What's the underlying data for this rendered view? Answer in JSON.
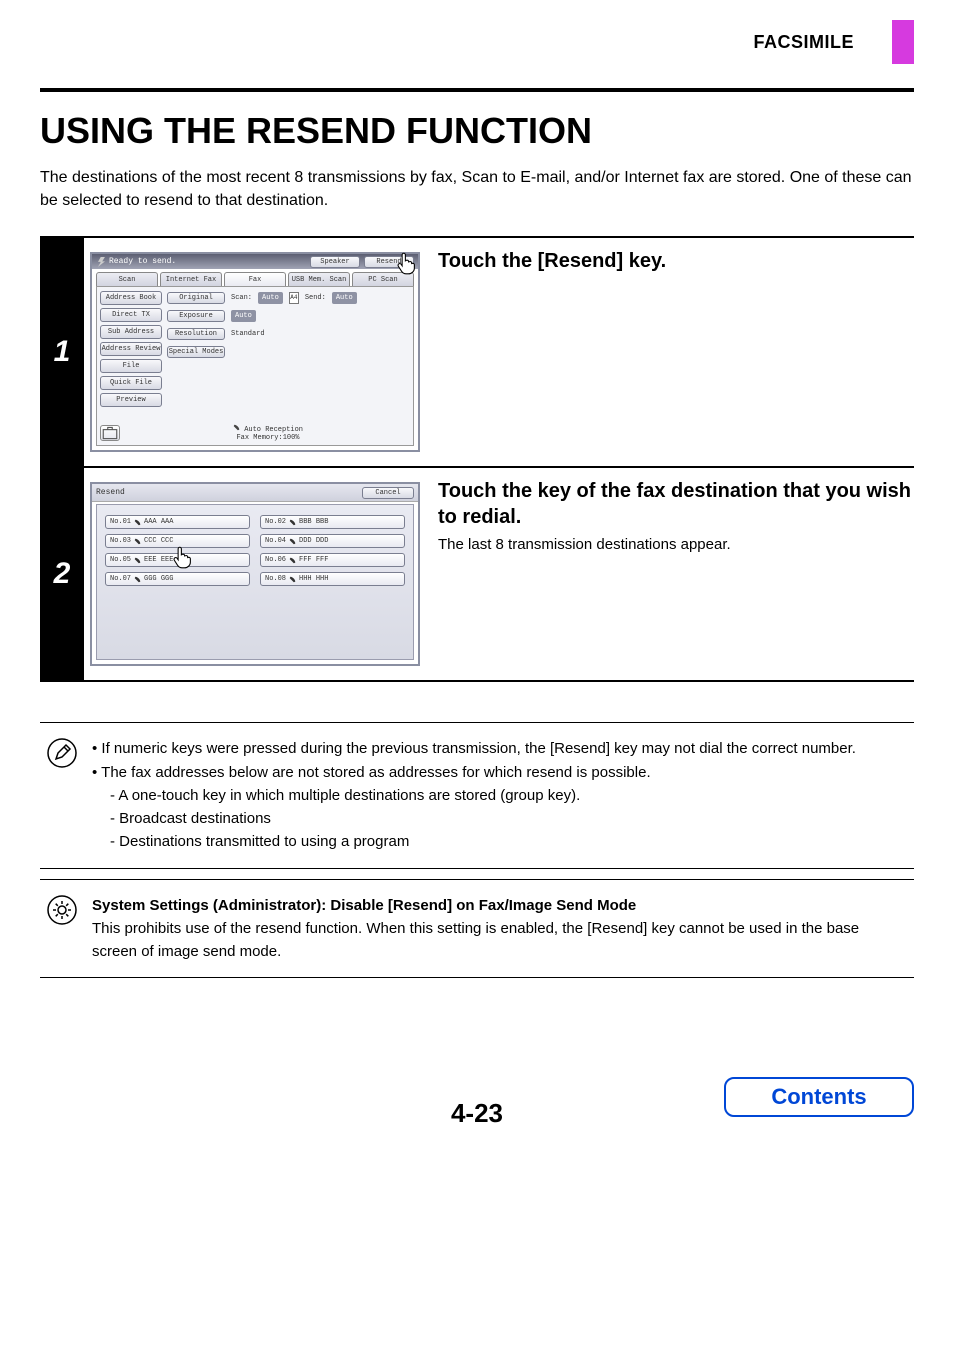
{
  "header": {
    "section": "FACSIMILE"
  },
  "title": "USING THE RESEND FUNCTION",
  "intro": "The destinations of the most recent 8 transmissions by fax, Scan to E-mail, and/or Internet fax are stored. One of these can be selected to resend to that destination.",
  "step1": {
    "num": "1",
    "heading": "Touch the [Resend] key.",
    "screen": {
      "status": "Ready to send.",
      "top_buttons": {
        "speaker": "Speaker",
        "resend": "Resend"
      },
      "tabs": [
        "Scan",
        "Internet Fax",
        "Fax",
        "USB Mem. Scan",
        "PC Scan"
      ],
      "side_buttons": [
        "Address Book",
        "Direct TX",
        "Sub Address",
        "Address Review",
        "File",
        "Quick File",
        "Preview"
      ],
      "rows": {
        "original": {
          "btn": "Original",
          "label": "Scan:",
          "chip": "Auto",
          "sheet": "A4",
          "label2": "Send:",
          "chip2": "Auto"
        },
        "exposure": {
          "btn": "Exposure",
          "val": "Auto"
        },
        "resolution": {
          "btn": "Resolution",
          "val": "Standard"
        },
        "special": {
          "btn": "Special Modes"
        }
      },
      "footer": {
        "line1": "Auto Reception",
        "line2": "Fax Memory:100%"
      }
    }
  },
  "step2": {
    "num": "2",
    "heading": "Touch the key of the fax destination that you wish to redial.",
    "sub": "The last 8 transmission destinations appear.",
    "screen": {
      "title": "Resend",
      "cancel": "Cancel",
      "items": [
        {
          "no": "No.01",
          "name": "AAA AAA"
        },
        {
          "no": "No.02",
          "name": "BBB BBB"
        },
        {
          "no": "No.03",
          "name": "CCC CCC"
        },
        {
          "no": "No.04",
          "name": "DDD DDD"
        },
        {
          "no": "No.05",
          "name": "EEE EEE"
        },
        {
          "no": "No.06",
          "name": "FFF FFF"
        },
        {
          "no": "No.07",
          "name": "GGG GGG"
        },
        {
          "no": "No.08",
          "name": "HHH HHH"
        }
      ]
    }
  },
  "notes": {
    "bul1": "If numeric keys were pressed during the previous transmission, the [Resend] key may not dial the correct number.",
    "bul2": "The fax addresses below are not stored as addresses for which resend is possible.",
    "d1": "A one-touch key in which multiple destinations are stored (group key).",
    "d2": "Broadcast destinations",
    "d3": "Destinations transmitted to using a program"
  },
  "admin": {
    "title": "System Settings (Administrator): Disable [Resend] on Fax/Image Send Mode",
    "body": "This prohibits use of the resend function. When this setting is enabled, the [Resend] key cannot be used in the base screen of image send mode."
  },
  "page_num": "4-23",
  "contents_btn": "Contents"
}
